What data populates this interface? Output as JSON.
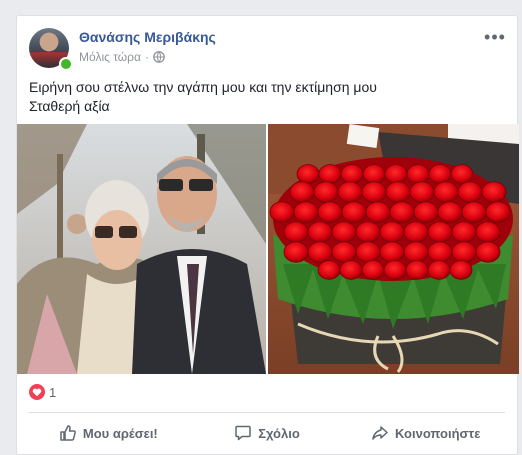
{
  "post": {
    "author": "Θανάσης Μεριβάκης",
    "timestamp": "Μόλις τώρα",
    "audience_icon": "globe-icon",
    "text_lines": [
      "Ειρήνη σου στέλνω την αγάπη μου και την εκτίμηση μου",
      "Σταθερή αξία"
    ],
    "photos": [
      "photo-couple",
      "photo-red-roses-box"
    ],
    "reactions": {
      "icon": "love-icon",
      "count": "1"
    },
    "actions": {
      "like": "Μου αρέσει!",
      "comment": "Σχόλιο",
      "share": "Κοινοποιήστε"
    }
  },
  "colors": {
    "page_bg": "#e9ebee",
    "author_link": "#385898",
    "love": "#f33e58",
    "online": "#42b72a"
  }
}
